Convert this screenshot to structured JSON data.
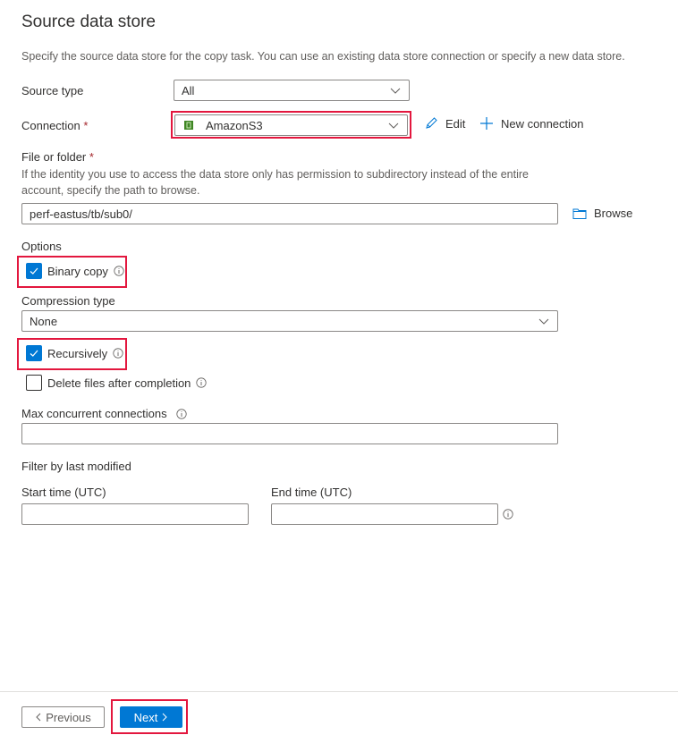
{
  "header": {
    "title": "Source data store",
    "description": "Specify the source data store for the copy task. You can use an existing data store connection or specify a new data store."
  },
  "source_type": {
    "label": "Source type",
    "value": "All"
  },
  "connection": {
    "label": "Connection",
    "required_mark": "*",
    "value": "AmazonS3",
    "icon": "amazon-s3-icon",
    "edit_label": "Edit",
    "new_connection_label": "New connection"
  },
  "file_or_folder": {
    "label": "File or folder",
    "required_mark": "*",
    "help_line1": "If the identity you use to access the data store only has permission to subdirectory instead of the entire",
    "help_line2": "account, specify the path to browse.",
    "value": "perf-eastus/tb/sub0/",
    "browse_label": "Browse"
  },
  "options": {
    "label": "Options",
    "binary_copy": {
      "label": "Binary copy",
      "checked": true
    },
    "compression_type": {
      "label": "Compression type",
      "value": "None"
    },
    "recursively": {
      "label": "Recursively",
      "checked": true
    },
    "delete_files": {
      "label": "Delete files after completion",
      "checked": false
    }
  },
  "max_concurrent": {
    "label": "Max concurrent connections",
    "value": ""
  },
  "filter": {
    "label": "Filter by last modified",
    "start_label": "Start time (UTC)",
    "start_value": "",
    "end_label": "End time (UTC)",
    "end_value": ""
  },
  "footer": {
    "previous_label": "Previous",
    "next_label": "Next"
  },
  "colors": {
    "accent": "#0078d4",
    "highlight": "#e3173e",
    "required": "#a4262c"
  }
}
